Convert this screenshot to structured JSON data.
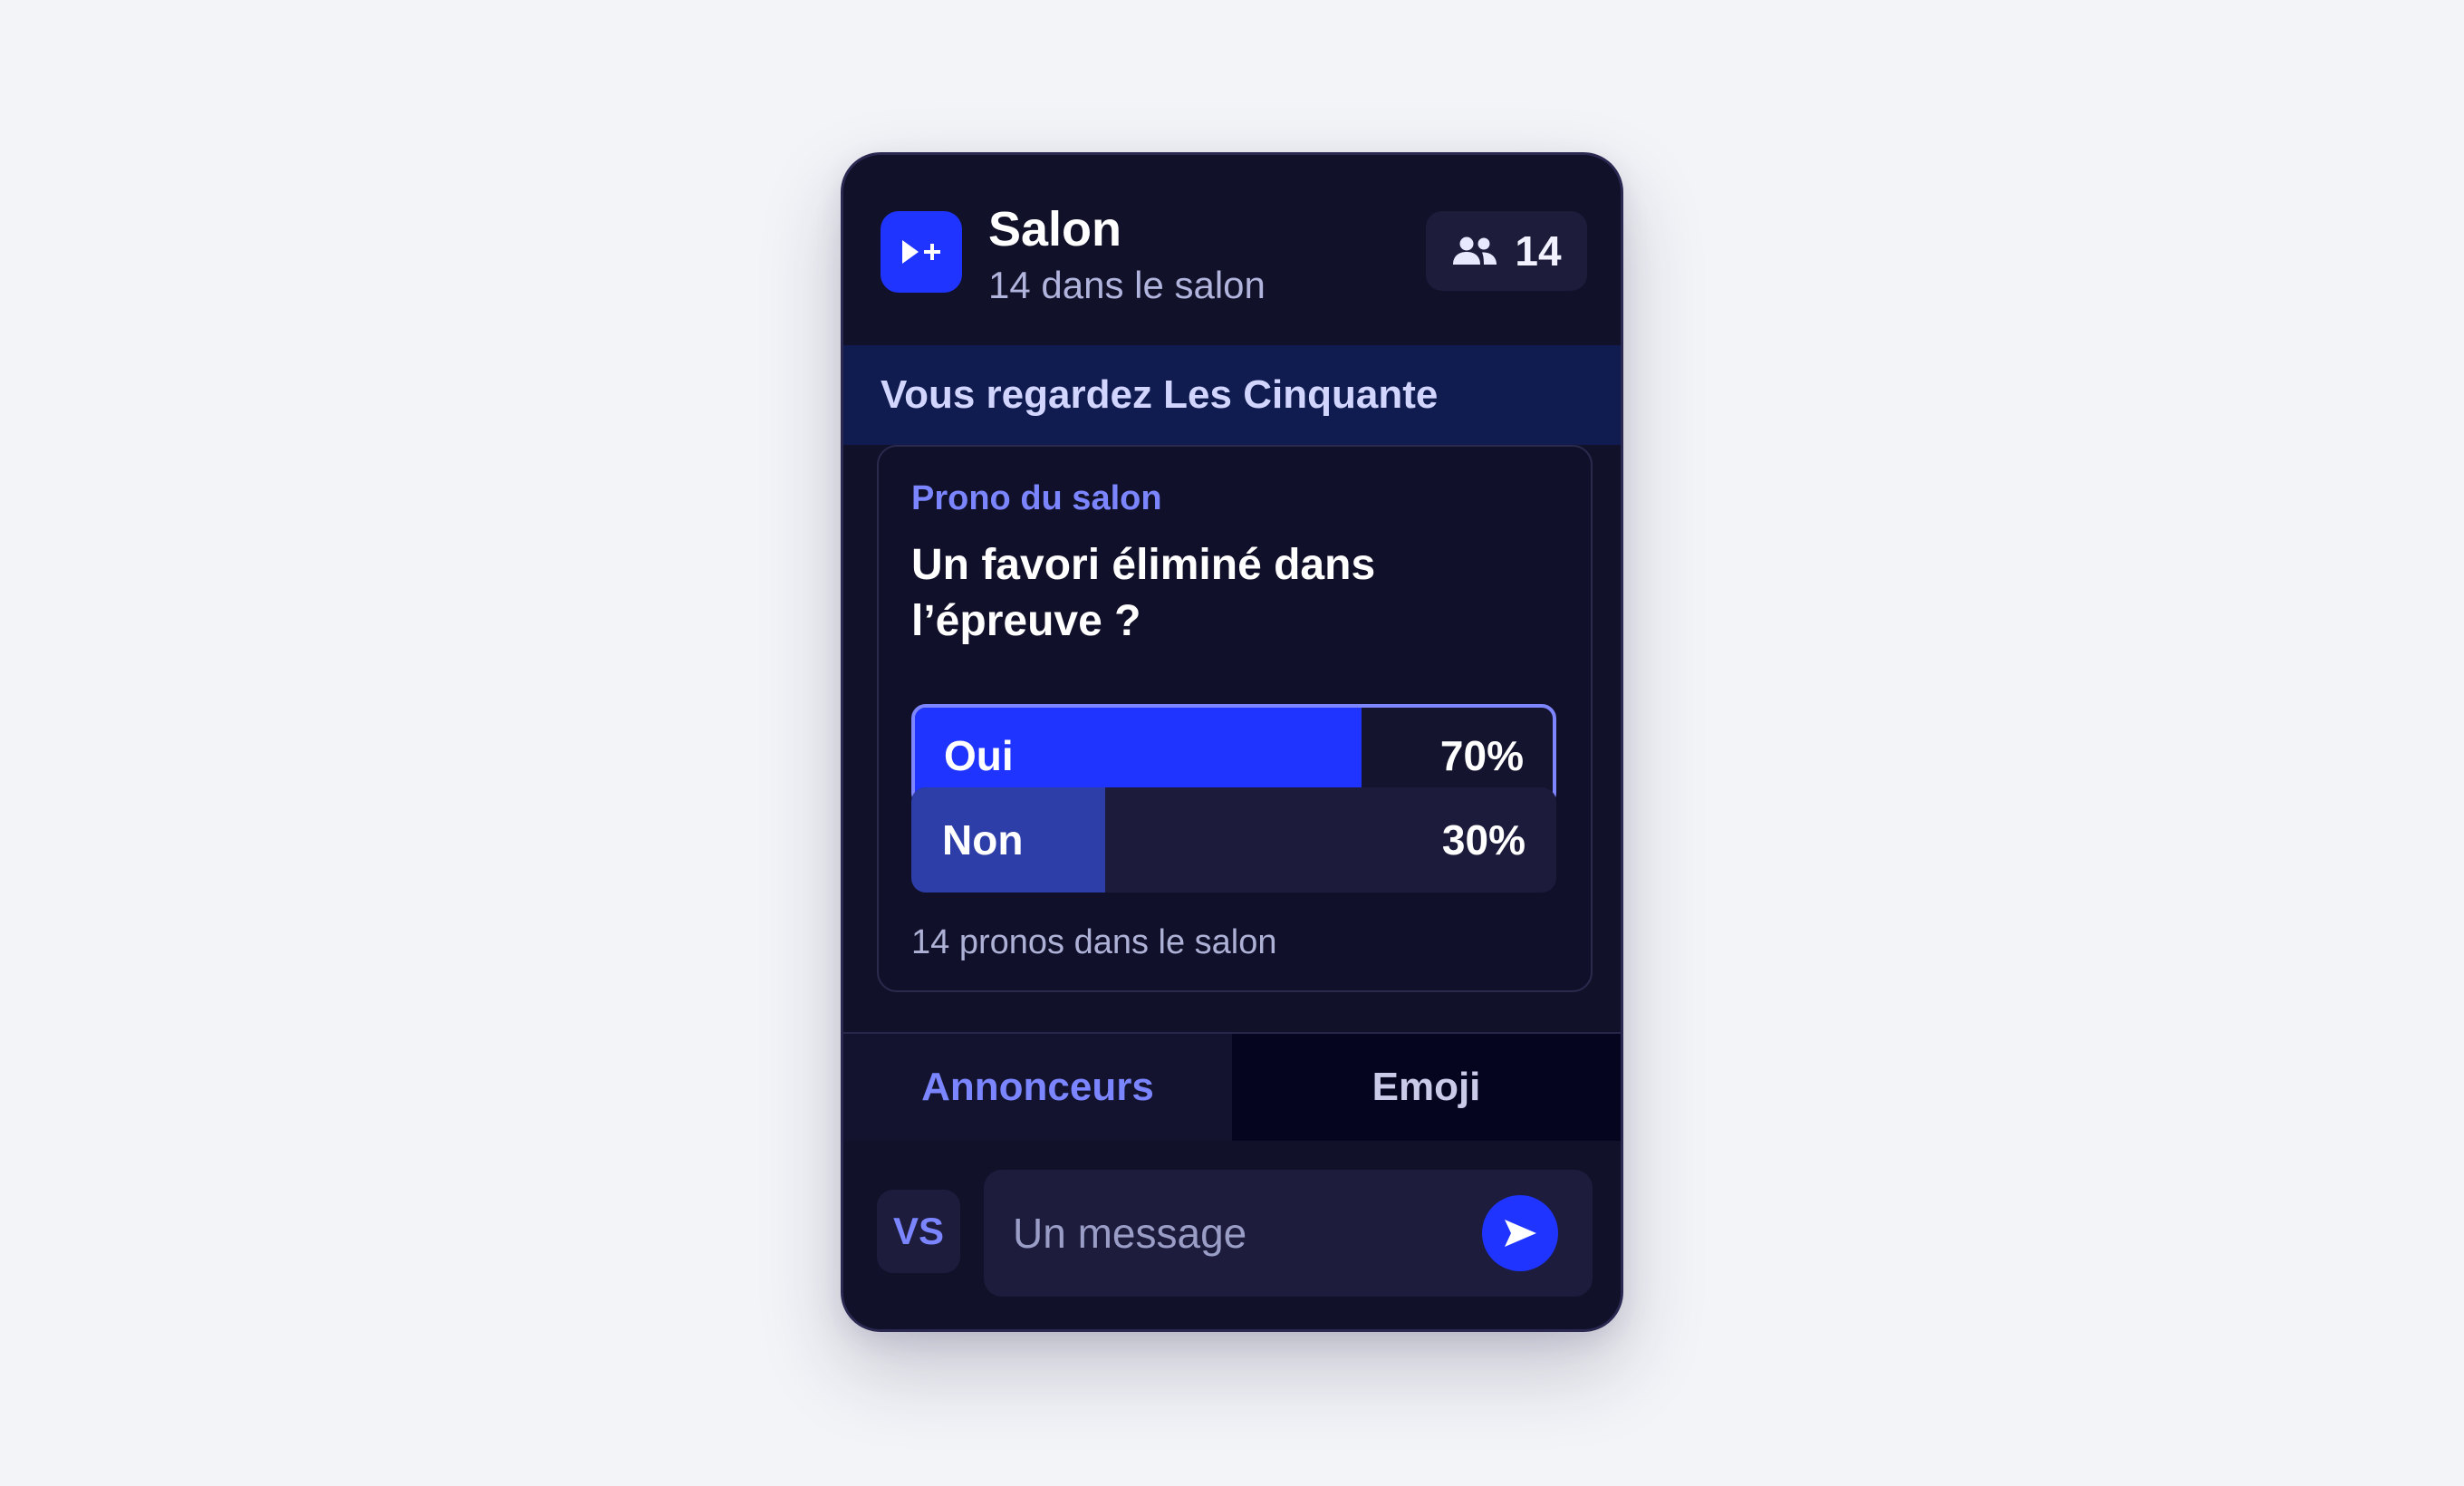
{
  "header": {
    "title": "Salon",
    "subtitle": "14 dans le salon",
    "viewer_count": "14",
    "app_icon": "play-plus-icon",
    "people_icon": "people-icon"
  },
  "banner": {
    "text": "Vous regardez Les Cinquante"
  },
  "poll": {
    "label": "Prono du salon",
    "question": "Un favori éliminé dans l’épreuve ?",
    "options": [
      {
        "label": "Oui",
        "percent": "70%",
        "value": 70,
        "selected": true,
        "color": "#1f35ff"
      },
      {
        "label": "Non",
        "percent": "30%",
        "value": 30,
        "selected": false,
        "color": "#2d3ea8"
      }
    ],
    "footer": "14 pronos dans le salon"
  },
  "tabs": [
    {
      "label": "Annonceurs",
      "active": true
    },
    {
      "label": "Emoji",
      "active": false
    }
  ],
  "composer": {
    "avatar_initials": "VS",
    "placeholder": "Un message",
    "value": "",
    "send_icon": "send-arrow-icon"
  },
  "colors": {
    "accent": "#1f35ff",
    "accent_light": "#7a85ff",
    "card_bg": "#12112a",
    "banner_bg": "#101c50",
    "page_bg": "#f3f4f8"
  }
}
